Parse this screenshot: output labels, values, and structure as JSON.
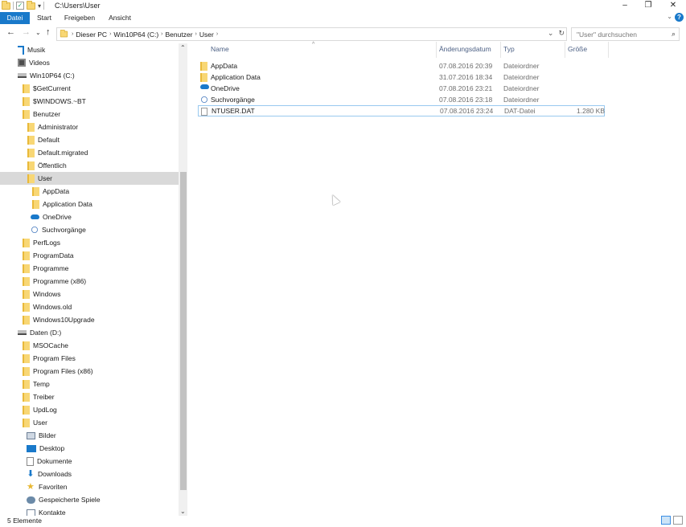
{
  "window": {
    "title": "C:\\Users\\User",
    "minimize": "–",
    "maximize": "❐",
    "close": "✕"
  },
  "ribbon": {
    "tabs": [
      "Datei",
      "Start",
      "Freigeben",
      "Ansicht"
    ],
    "help": "?",
    "expand": "⌄"
  },
  "nav": {
    "back": "←",
    "forward": "→",
    "recent": "⌄",
    "up": "↑",
    "breadcrumb": [
      "Dieser PC",
      "Win10P64 (C:)",
      "Benutzer",
      "User"
    ],
    "crumb_sep": "›",
    "dropdown": "⌄",
    "refresh": "↻",
    "search_placeholder": "\"User\" durchsuchen",
    "search_icon": "⌕"
  },
  "tree": [
    {
      "label": "Musik",
      "icon": "music",
      "indent": 22
    },
    {
      "label": "Videos",
      "icon": "video",
      "indent": 22
    },
    {
      "label": "Win10P64 (C:)",
      "icon": "drive",
      "indent": 22
    },
    {
      "label": "$GetCurrent",
      "icon": "folder",
      "indent": 28
    },
    {
      "label": "$WINDOWS.~BT",
      "icon": "folder",
      "indent": 28
    },
    {
      "label": "Benutzer",
      "icon": "folder",
      "indent": 28
    },
    {
      "label": "Administrator",
      "icon": "folder",
      "indent": 34
    },
    {
      "label": "Default",
      "icon": "folder",
      "indent": 34
    },
    {
      "label": "Default.migrated",
      "icon": "folder",
      "indent": 34
    },
    {
      "label": "Öffentlich",
      "icon": "folder",
      "indent": 34
    },
    {
      "label": "User",
      "icon": "folder",
      "indent": 34,
      "selected": true
    },
    {
      "label": "AppData",
      "icon": "folder",
      "indent": 40
    },
    {
      "label": "Application Data",
      "icon": "folder",
      "indent": 40
    },
    {
      "label": "OneDrive",
      "icon": "onedrive",
      "indent": 38
    },
    {
      "label": "Suchvorgänge",
      "icon": "search-fold",
      "indent": 38
    },
    {
      "label": "PerfLogs",
      "icon": "folder",
      "indent": 28
    },
    {
      "label": "ProgramData",
      "icon": "folder",
      "indent": 28
    },
    {
      "label": "Programme",
      "icon": "folder",
      "indent": 28
    },
    {
      "label": "Programme (x86)",
      "icon": "folder",
      "indent": 28
    },
    {
      "label": "Windows",
      "icon": "folder",
      "indent": 28
    },
    {
      "label": "Windows.old",
      "icon": "folder",
      "indent": 28
    },
    {
      "label": "Windows10Upgrade",
      "icon": "folder",
      "indent": 28
    },
    {
      "label": "Daten (D:)",
      "icon": "drive",
      "indent": 22
    },
    {
      "label": "MSOCache",
      "icon": "folder",
      "indent": 28
    },
    {
      "label": "Program Files",
      "icon": "folder",
      "indent": 28
    },
    {
      "label": "Program Files (x86)",
      "icon": "folder",
      "indent": 28
    },
    {
      "label": "Temp",
      "icon": "folder",
      "indent": 28
    },
    {
      "label": "Treiber",
      "icon": "folder",
      "indent": 28
    },
    {
      "label": "UpdLog",
      "icon": "folder",
      "indent": 28
    },
    {
      "label": "User",
      "icon": "folder",
      "indent": 28
    },
    {
      "label": "Bilder",
      "icon": "pictures",
      "indent": 33
    },
    {
      "label": "Desktop",
      "icon": "desktop",
      "indent": 33
    },
    {
      "label": "Dokumente",
      "icon": "docs",
      "indent": 33
    },
    {
      "label": "Downloads",
      "icon": "downloads",
      "indent": 33
    },
    {
      "label": "Favoriten",
      "icon": "star",
      "indent": 33
    },
    {
      "label": "Gespeicherte Spiele",
      "icon": "games",
      "indent": 33
    },
    {
      "label": "Kontakte",
      "icon": "contacts",
      "indent": 33
    }
  ],
  "columns": {
    "name": "Name",
    "date": "Änderungsdatum",
    "type": "Typ",
    "size": "Größe"
  },
  "files": [
    {
      "name": "AppData",
      "date": "07.08.2016 20:39",
      "type": "Dateiordner",
      "size": "",
      "icon": "folder"
    },
    {
      "name": "Application Data",
      "date": "31.07.2016 18:34",
      "type": "Dateiordner",
      "size": "",
      "icon": "folder"
    },
    {
      "name": "OneDrive",
      "date": "07.08.2016 23:21",
      "type": "Dateiordner",
      "size": "",
      "icon": "onedrive"
    },
    {
      "name": "Suchvorgänge",
      "date": "07.08.2016 23:18",
      "type": "Dateiordner",
      "size": "",
      "icon": "search-fold"
    },
    {
      "name": "NTUSER.DAT",
      "date": "07.08.2016 23:24",
      "type": "DAT-Datei",
      "size": "1.280 KB",
      "icon": "dat",
      "focused": true
    }
  ],
  "status": {
    "count": "5 Elemente"
  }
}
